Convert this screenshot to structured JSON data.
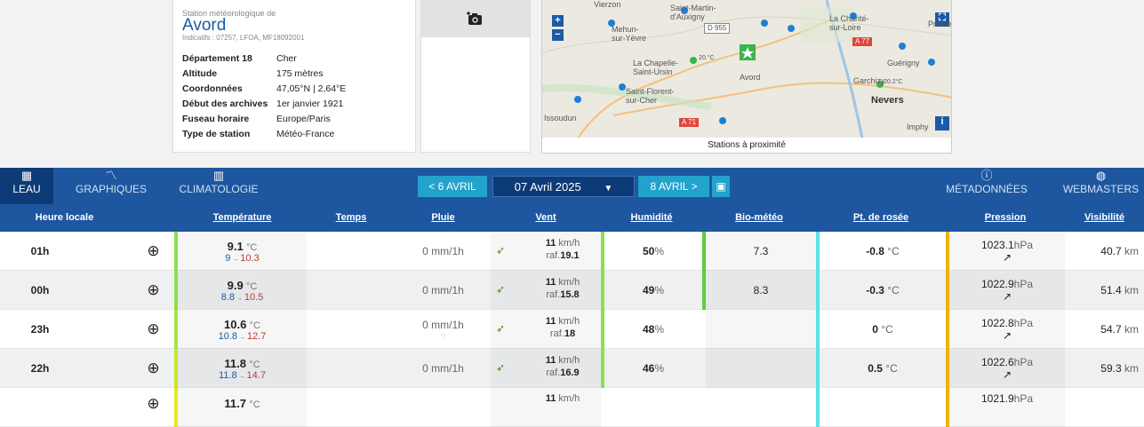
{
  "station": {
    "subtitle": "Station météorologique de",
    "name": "Avord",
    "indicatifs": "Indicatifs : 07257, LFOA, MF18092001",
    "details": [
      {
        "label": "Département 18",
        "value": "Cher"
      },
      {
        "label": "Altitude",
        "value": "175 mètres"
      },
      {
        "label": "Coordonnées",
        "value": "47,05°N | 2,64°E"
      },
      {
        "label": "Début des archives",
        "value": "1er janvier 1921"
      },
      {
        "label": "Fuseau horaire",
        "value": "Europe/Paris"
      },
      {
        "label": "Type de station",
        "value": "Météo-France"
      }
    ]
  },
  "photo_icon": "add-photo-icon",
  "map": {
    "footer": "Stations à proximité",
    "labels": {
      "vierzon": "Vierzon",
      "saint_martin": "Saint-Martin-\nd'Auxigny",
      "mehun": "Mehun-\nsur-Yèvre",
      "lachapelle": "La Chapelle-\nSaint-Ursin",
      "avord": "Avord",
      "saint_florent": "Saint-Florent-\nsur-Cher",
      "issoudun": "Issoudun",
      "lacharite": "La Charité-\nsur-Loire",
      "premery": "Prémer",
      "guerigny": "Guérigny",
      "garchizy": "Garchizy",
      "nevers": "Nevers",
      "imphy": "Imphy",
      "d955": "D 955",
      "a71": "A 71",
      "a77": "A 77",
      "temp1": "20.°C",
      "temp2": "20.2°C"
    }
  },
  "toolbar": {
    "tabs": [
      {
        "label": "LEAU",
        "icon": "table-icon"
      },
      {
        "label": "GRAPHIQUES",
        "icon": "chart-line-icon"
      },
      {
        "label": "CLIMATOLOGIE",
        "icon": "bar-chart-icon"
      }
    ],
    "prev_label": "< 6 AVRIL",
    "date_label": "07 Avril 2025",
    "next_label": "8 AVRIL >",
    "metadata_label": "MÉTADONNÉES",
    "webmasters_label": "WEBMASTERS"
  },
  "table": {
    "headers": [
      "Heure locale",
      "Température",
      "Temps",
      "Pluie",
      "Vent",
      "Humidité",
      "Bio-météo",
      "Pt. de rosée",
      "Pression",
      "Visibilité"
    ],
    "rows": [
      {
        "hour": "01h",
        "temp": "9.1",
        "tmin": "9",
        "tmax": "10.3",
        "rain": "0 mm/1h",
        "wind": "11",
        "gust": "19.1",
        "hum": "50",
        "bio": "7.3",
        "dew": "-0.8",
        "press": "1023.1",
        "vis": "40.7",
        "vis_unit": "km"
      },
      {
        "hour": "00h",
        "temp": "9.9",
        "tmin": "8.8",
        "tmax": "10.5",
        "rain": "0 mm/1h",
        "wind": "11",
        "gust": "15.8",
        "hum": "49",
        "bio": "8.3",
        "dew": "-0.3",
        "press": "1022.9",
        "vis": "51.4",
        "vis_unit": "km"
      },
      {
        "hour": "23h",
        "temp": "10.6",
        "tmin": "10.8",
        "tmax": "12.7",
        "rain": "0 mm/1h",
        "wind": "11",
        "gust": "18",
        "hum": "48",
        "bio": "",
        "dew": "0",
        "press": "1022.8",
        "vis": "54.7",
        "vis_unit": "km"
      },
      {
        "hour": "22h",
        "temp": "11.8",
        "tmin": "11.8",
        "tmax": "14.7",
        "rain": "0 mm/1h",
        "wind": "11",
        "gust": "16.9",
        "hum": "46",
        "bio": "",
        "dew": "0.5",
        "press": "1022.6",
        "vis": "59.3",
        "vis_unit": "km"
      },
      {
        "hour": "",
        "temp": "11.7",
        "tmin": "",
        "tmax": "",
        "rain": "",
        "wind": "11",
        "gust": "",
        "hum": "",
        "bio": "",
        "dew": "",
        "press": "1021.9",
        "vis": "",
        "vis_unit": ""
      }
    ],
    "units": {
      "temp": "°C",
      "wind": "km/h",
      "gust_prefix": "raf.",
      "hum": "%",
      "dew": "°C",
      "press": "hPa"
    }
  },
  "colors": {
    "toolbar": "#1e56a0",
    "accent": "#23a3cc",
    "active_tab": "#0d3b78"
  }
}
